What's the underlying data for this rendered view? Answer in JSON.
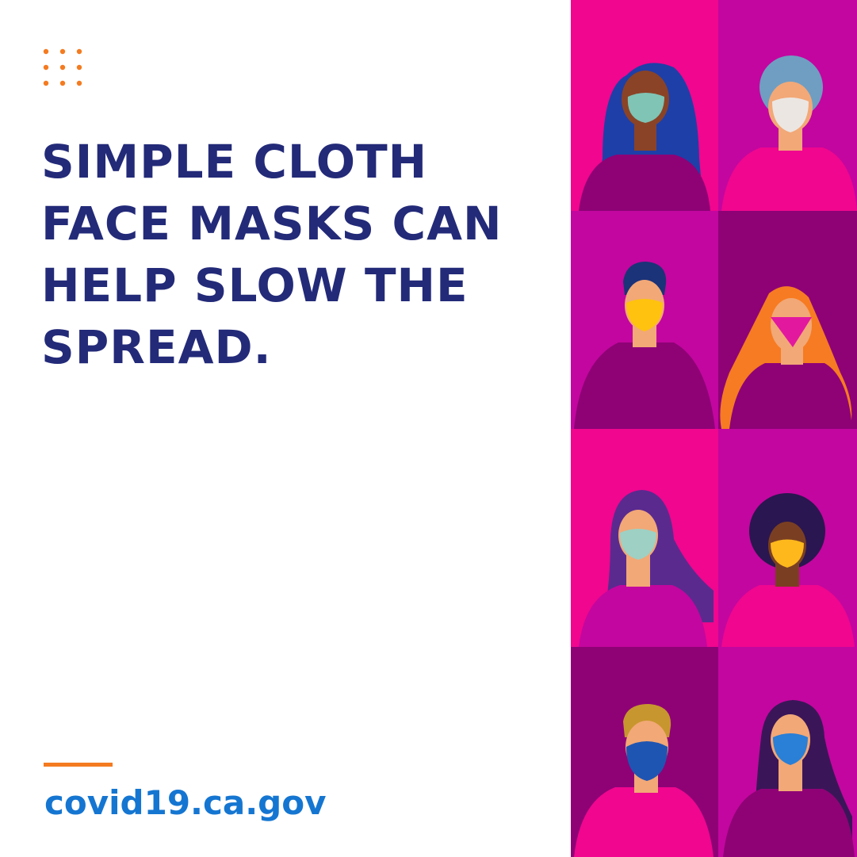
{
  "headline_lines": [
    "SIMPLE CLOTH",
    "FACE MASKS CAN",
    "HELP SLOW THE",
    "SPREAD."
  ],
  "website": "covid19.ca.gov",
  "colors": {
    "headline": "#232a78",
    "accent": "#f47b20",
    "link": "#1576d1",
    "tile_pink": "#f0068f",
    "tile_magenta": "#c3069f",
    "tile_purple": "#8e0276"
  },
  "illustration": {
    "subject": "grid of eight people wearing cloth face masks"
  }
}
